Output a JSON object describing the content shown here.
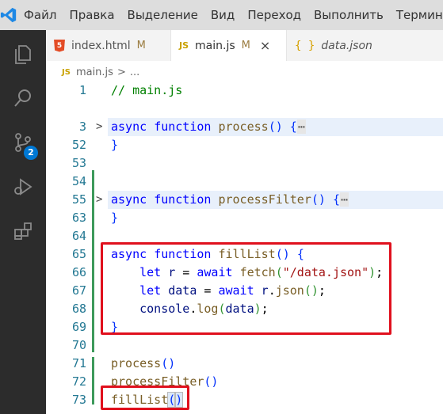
{
  "menu": [
    "Файл",
    "Правка",
    "Выделение",
    "Вид",
    "Переход",
    "Выполнить",
    "Термина"
  ],
  "activity": {
    "scm_badge": "2"
  },
  "tabs": [
    {
      "name": "index.html",
      "status": "M",
      "icon": "html5-icon"
    },
    {
      "name": "main.js",
      "status": "M",
      "icon": "js-icon",
      "active": true
    },
    {
      "name": "data.json",
      "status": "",
      "icon": "json-braces-icon"
    }
  ],
  "icon_labels": {
    "html": "5",
    "js": "JS",
    "json": "{ }"
  },
  "breadcrumb": {
    "file": "main.js",
    "separator": ">",
    "rest": "..."
  },
  "editor": {
    "lines": [
      {
        "n": "1"
      },
      {
        "n": "3"
      },
      {
        "n": "52"
      },
      {
        "n": "53"
      },
      {
        "n": "54"
      },
      {
        "n": "55"
      },
      {
        "n": "63"
      },
      {
        "n": "64"
      },
      {
        "n": "65"
      },
      {
        "n": "66"
      },
      {
        "n": "67"
      },
      {
        "n": "68"
      },
      {
        "n": "69"
      },
      {
        "n": "70"
      },
      {
        "n": "71"
      },
      {
        "n": "72"
      },
      {
        "n": "73"
      }
    ],
    "tokens": {
      "comment": "// main.js",
      "async": "async",
      "function": "function",
      "process": "process",
      "processFilter": "processFilter",
      "fillList": "fillList",
      "let": "let",
      "await": "await",
      "r": "r",
      "data": "data",
      "fetch": "fetch",
      "url": "\"/data.json\"",
      "json": "json",
      "console": "console",
      "log": "log",
      "folded": "⋯"
    }
  },
  "colors": {
    "accent": "#0078d4",
    "highlight_box": "#e0101d",
    "git_added": "#3d9a5b"
  }
}
